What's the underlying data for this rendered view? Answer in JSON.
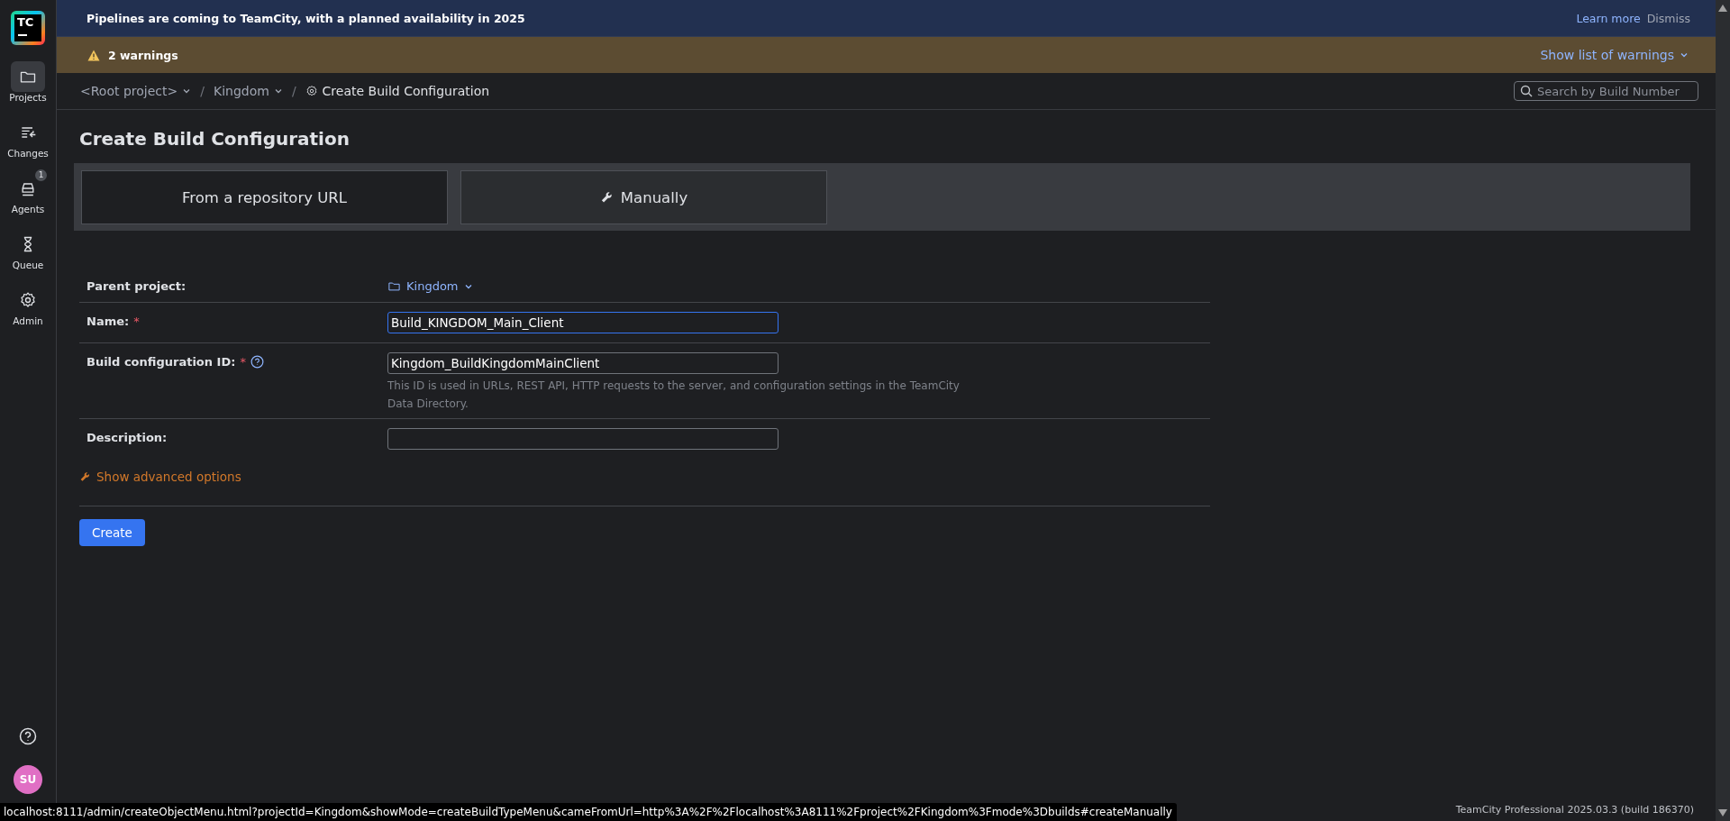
{
  "sidebar": {
    "logo": "TC",
    "items": [
      {
        "label": "Projects",
        "selected": true
      },
      {
        "label": "Changes",
        "selected": false
      },
      {
        "label": "Agents",
        "selected": false,
        "badge": "1"
      },
      {
        "label": "Queue",
        "selected": false
      },
      {
        "label": "Admin",
        "selected": false
      }
    ],
    "avatar": "SU"
  },
  "announcement": {
    "text": "Pipelines are coming to TeamCity, with a planned availability in 2025",
    "links": [
      "Learn more",
      "Dismiss"
    ]
  },
  "warnings": {
    "text": "2 warnings",
    "toggle": "Show list of warnings"
  },
  "breadcrumbs": [
    {
      "label": "<Root project>",
      "kind": "link",
      "dropdown": true
    },
    {
      "separator": "/",
      "label": "Kingdom",
      "kind": "link",
      "dropdown": true
    },
    {
      "separator": "/",
      "label": "Create Build Configuration",
      "kind": "current",
      "dropdown": false
    }
  ],
  "search": {
    "placeholder": "Search by Build Number"
  },
  "page_title": "Create Build Configuration",
  "tabs": [
    {
      "label": "From a repository URL",
      "kind": "url",
      "selected": false
    },
    {
      "label": "Manually",
      "kind": "manual",
      "selected": true
    }
  ],
  "form": {
    "rows": [
      {
        "kind": "project",
        "label": "Parent project:",
        "value": "Kingdom"
      },
      {
        "kind": "input",
        "label": "Name:",
        "required_mark": "*",
        "value": "Build_KINGDOM_Main_Client",
        "focused": true
      },
      {
        "kind": "input",
        "label": "Build configuration ID:",
        "required_mark": "*",
        "help": true,
        "value": "Kingdom_BuildKingdomMainClient",
        "focused": false,
        "note": "This ID is used in URLs, REST API, HTTP requests to the server, and configuration settings in the TeamCity Data Directory."
      },
      {
        "kind": "input",
        "label": "Description:",
        "focused": false
      }
    ],
    "advanced_link": "Show advanced options",
    "submit": "Create"
  },
  "status_url": "localhost:8111/admin/createObjectMenu.html?projectId=Kingdom&showMode=createBuildTypeMenu&cameFromUrl=http%3A%2F%2Flocalhost%3A8111%2Fproject%2FKingdom%3Fmode%3Dbuilds#createManually",
  "version": "TeamCity Professional 2025.03.3 (build 186370)"
}
